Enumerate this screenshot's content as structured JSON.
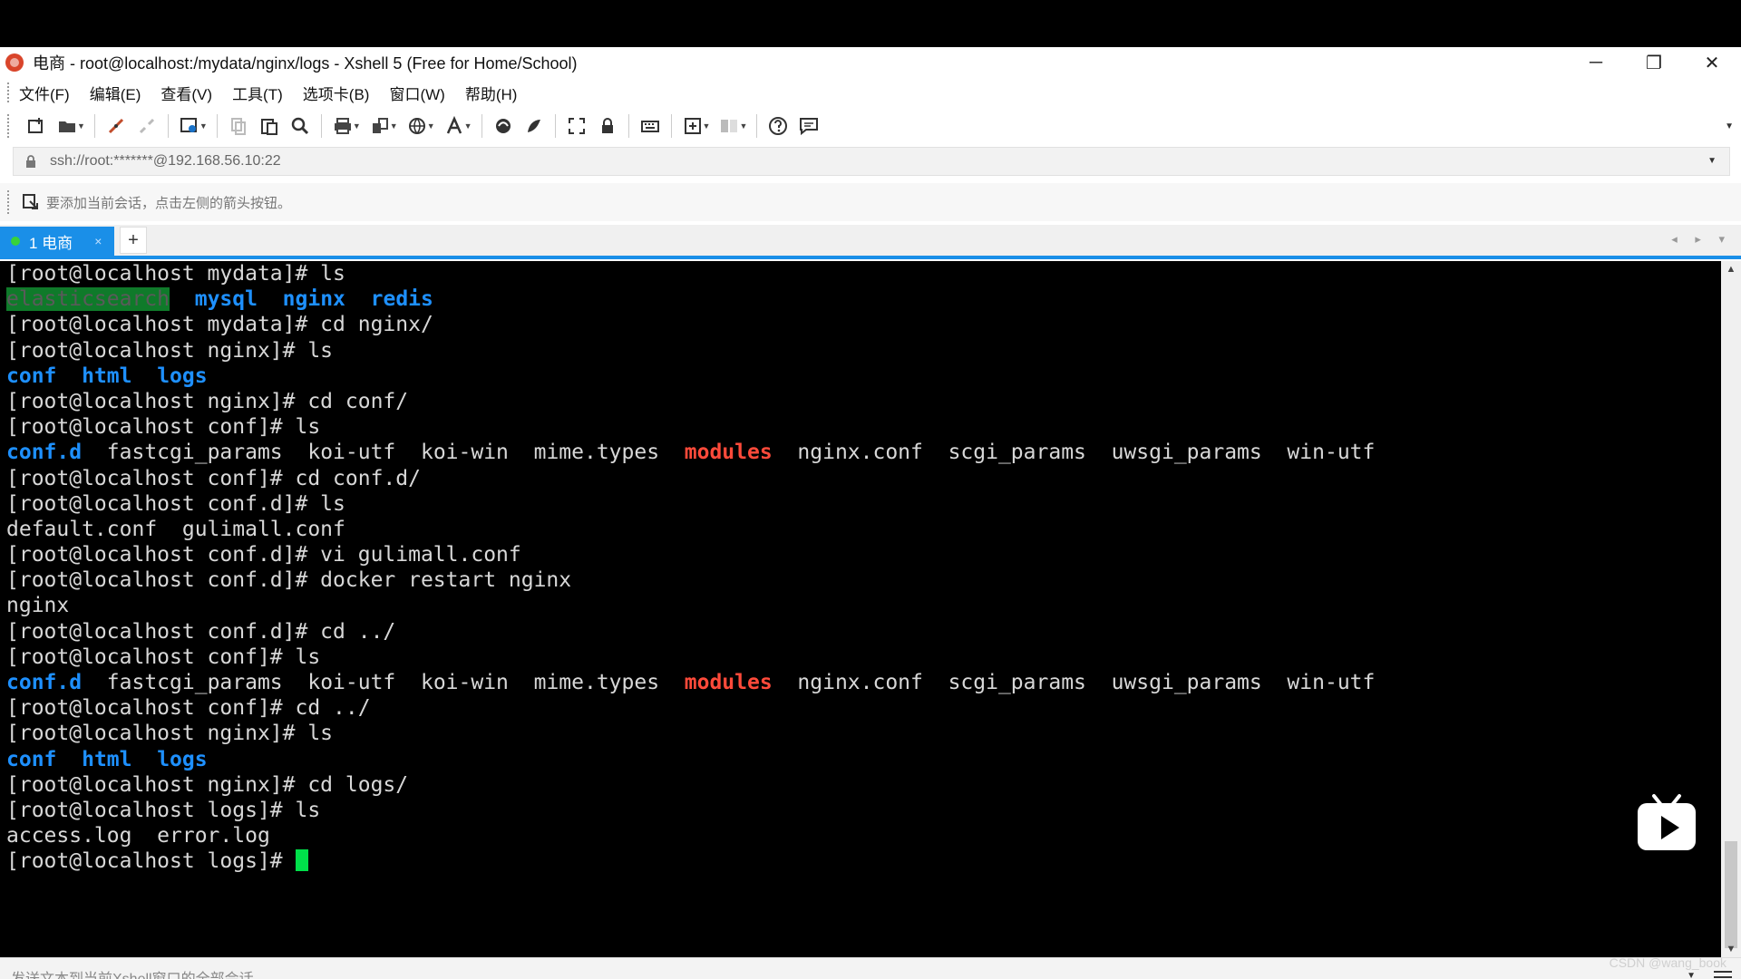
{
  "window": {
    "title": "电商 - root@localhost:/mydata/nginx/logs - Xshell 5 (Free for Home/School)",
    "controls": {
      "minimize": "─",
      "restore": "❐",
      "close": "✕"
    }
  },
  "menu": {
    "items": [
      "文件(F)",
      "编辑(E)",
      "查看(V)",
      "工具(T)",
      "选项卡(B)",
      "窗口(W)",
      "帮助(H)"
    ]
  },
  "toolbar": {
    "icons": [
      "new-session-icon",
      "open-folder-icon",
      "reconnect-icon",
      "disconnect-icon",
      "properties-icon",
      "copy-icon",
      "paste-icon",
      "find-icon",
      "print-icon",
      "transfer-icon",
      "globe-icon",
      "font-icon",
      "xftp-icon",
      "xmanager-icon",
      "fullscreen-icon",
      "lock-icon",
      "keyboard-icon",
      "add-icon",
      "layout-icon",
      "help-icon",
      "chat-icon"
    ]
  },
  "address": {
    "value": "ssh://root:*******@192.168.56.10:22"
  },
  "session": {
    "hint": "要添加当前会话，点击左侧的箭头按钮。"
  },
  "tabs": {
    "active_label": "1 电商",
    "close": "×",
    "add": "+",
    "nav": "◂ ▸ ▾"
  },
  "terminal": {
    "lines": [
      [
        {
          "t": "[root@localhost mydata]# ls",
          "s": "n"
        }
      ],
      [
        {
          "t": "elasticsearch",
          "s": "hl"
        },
        {
          "t": "  ",
          "s": "n"
        },
        {
          "t": "mysql",
          "s": "dir"
        },
        {
          "t": "  ",
          "s": "n"
        },
        {
          "t": "nginx",
          "s": "dir"
        },
        {
          "t": "  ",
          "s": "n"
        },
        {
          "t": "redis",
          "s": "dir"
        }
      ],
      [
        {
          "t": "[root@localhost mydata]# cd nginx/",
          "s": "n"
        }
      ],
      [
        {
          "t": "[root@localhost nginx]# ls",
          "s": "n"
        }
      ],
      [
        {
          "t": "conf",
          "s": "dir"
        },
        {
          "t": "  ",
          "s": "n"
        },
        {
          "t": "html",
          "s": "dir"
        },
        {
          "t": "  ",
          "s": "n"
        },
        {
          "t": "logs",
          "s": "dir"
        }
      ],
      [
        {
          "t": "[root@localhost nginx]# cd conf/",
          "s": "n"
        }
      ],
      [
        {
          "t": "[root@localhost conf]# ls",
          "s": "n"
        }
      ],
      [
        {
          "t": "conf.d",
          "s": "dir"
        },
        {
          "t": "  fastcgi_params  koi-utf  koi-win  mime.types  ",
          "s": "n"
        },
        {
          "t": "modules",
          "s": "red"
        },
        {
          "t": "  nginx.conf  scgi_params  uwsgi_params  win-utf",
          "s": "n"
        }
      ],
      [
        {
          "t": "[root@localhost conf]# cd conf.d/",
          "s": "n"
        }
      ],
      [
        {
          "t": "[root@localhost conf.d]# ls",
          "s": "n"
        }
      ],
      [
        {
          "t": "default.conf  gulimall.conf",
          "s": "n"
        }
      ],
      [
        {
          "t": "[root@localhost conf.d]# vi gulimall.conf",
          "s": "n"
        }
      ],
      [
        {
          "t": "[root@localhost conf.d]# docker restart nginx",
          "s": "n"
        }
      ],
      [
        {
          "t": "nginx",
          "s": "n"
        }
      ],
      [
        {
          "t": "[root@localhost conf.d]# cd ../",
          "s": "n"
        }
      ],
      [
        {
          "t": "[root@localhost conf]# ls",
          "s": "n"
        }
      ],
      [
        {
          "t": "conf.d",
          "s": "dir"
        },
        {
          "t": "  fastcgi_params  koi-utf  koi-win  mime.types  ",
          "s": "n"
        },
        {
          "t": "modules",
          "s": "red"
        },
        {
          "t": "  nginx.conf  scgi_params  uwsgi_params  win-utf",
          "s": "n"
        }
      ],
      [
        {
          "t": "[root@localhost conf]# cd ../",
          "s": "n"
        }
      ],
      [
        {
          "t": "[root@localhost nginx]# ls",
          "s": "n"
        }
      ],
      [
        {
          "t": "conf",
          "s": "dir"
        },
        {
          "t": "  ",
          "s": "n"
        },
        {
          "t": "html",
          "s": "dir"
        },
        {
          "t": "  ",
          "s": "n"
        },
        {
          "t": "logs",
          "s": "dir"
        }
      ],
      [
        {
          "t": "[root@localhost nginx]# cd logs/",
          "s": "n"
        }
      ],
      [
        {
          "t": "[root@localhost logs]# ls",
          "s": "n"
        }
      ],
      [
        {
          "t": "access.log  error.log",
          "s": "n"
        }
      ],
      [
        {
          "t": "[root@localhost logs]# ",
          "s": "n"
        },
        {
          "t": "",
          "s": "cursor"
        }
      ]
    ]
  },
  "sendbar": {
    "placeholder": "发送文本到当前Xshell窗口的全部会话"
  },
  "watermark": "CSDN @wang_book",
  "colors": {
    "accent": "#1a8fe8",
    "directory": "#1e90ff",
    "red_entry": "#ff4a3a",
    "cursor": "#00e04a",
    "highlight_bg": "#0f7a2a"
  }
}
